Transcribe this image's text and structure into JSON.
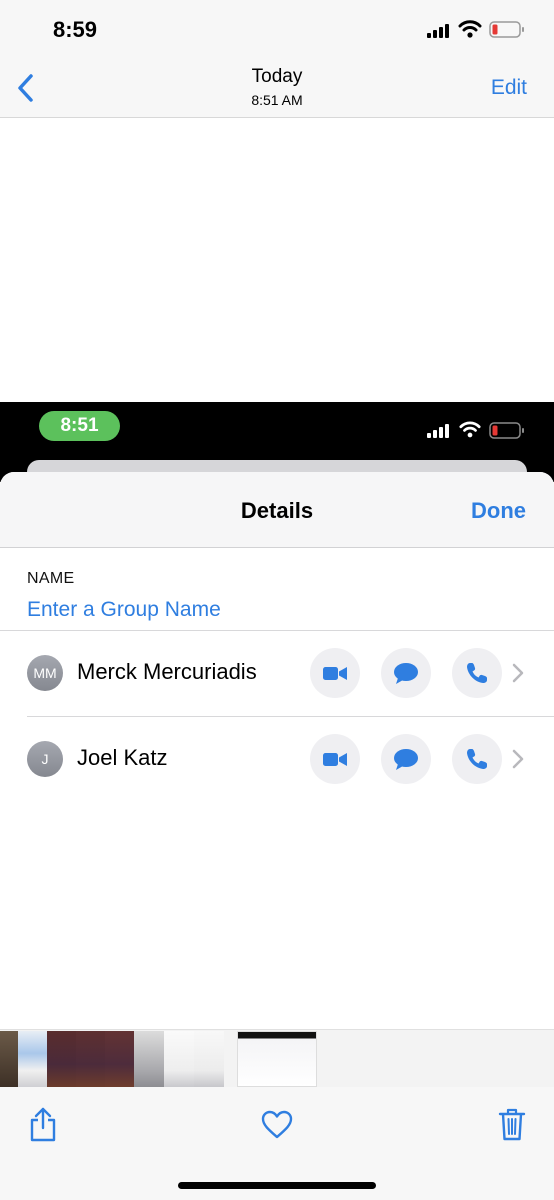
{
  "status_bar": {
    "time": "8:59"
  },
  "nav": {
    "title": "Today",
    "subtitle": "8:51 AM",
    "edit_label": "Edit"
  },
  "screenshot": {
    "status_time": "8:51",
    "sheet": {
      "title": "Details",
      "done_label": "Done",
      "name_label": "NAME",
      "group_name_placeholder": "Enter a Group Name",
      "contacts": [
        {
          "initials": "MM",
          "name": "Merck Mercuriadis"
        },
        {
          "initials": "J",
          "name": "Joel Katz"
        }
      ]
    }
  },
  "colors": {
    "accent": "#2f7ee0",
    "status_pill": "#5cc15c",
    "battery_low": "#e53935"
  },
  "icons": {
    "back": "chevron-left-icon",
    "video": "video-camera-icon",
    "message": "message-bubble-icon",
    "phone": "phone-icon",
    "share": "share-icon",
    "favorite": "heart-icon",
    "delete": "trash-icon"
  }
}
